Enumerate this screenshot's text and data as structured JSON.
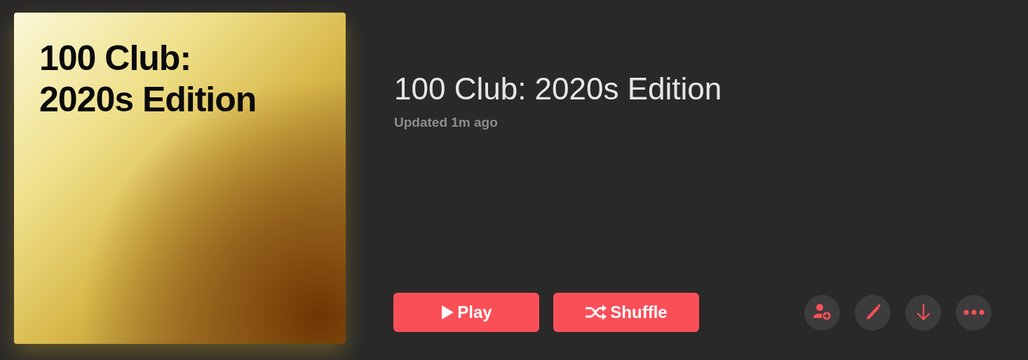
{
  "artwork": {
    "title": "100 Club:\n2020s Edition"
  },
  "playlist": {
    "title": "100 Club: 2020s Edition",
    "updated": "Updated 1m ago"
  },
  "buttons": [
    {
      "kind": "play",
      "label": "Play"
    },
    {
      "kind": "shuffle",
      "label": "Shuffle"
    }
  ],
  "actions": [
    {
      "kind": "add-person"
    },
    {
      "kind": "edit"
    },
    {
      "kind": "download"
    },
    {
      "kind": "more"
    }
  ]
}
